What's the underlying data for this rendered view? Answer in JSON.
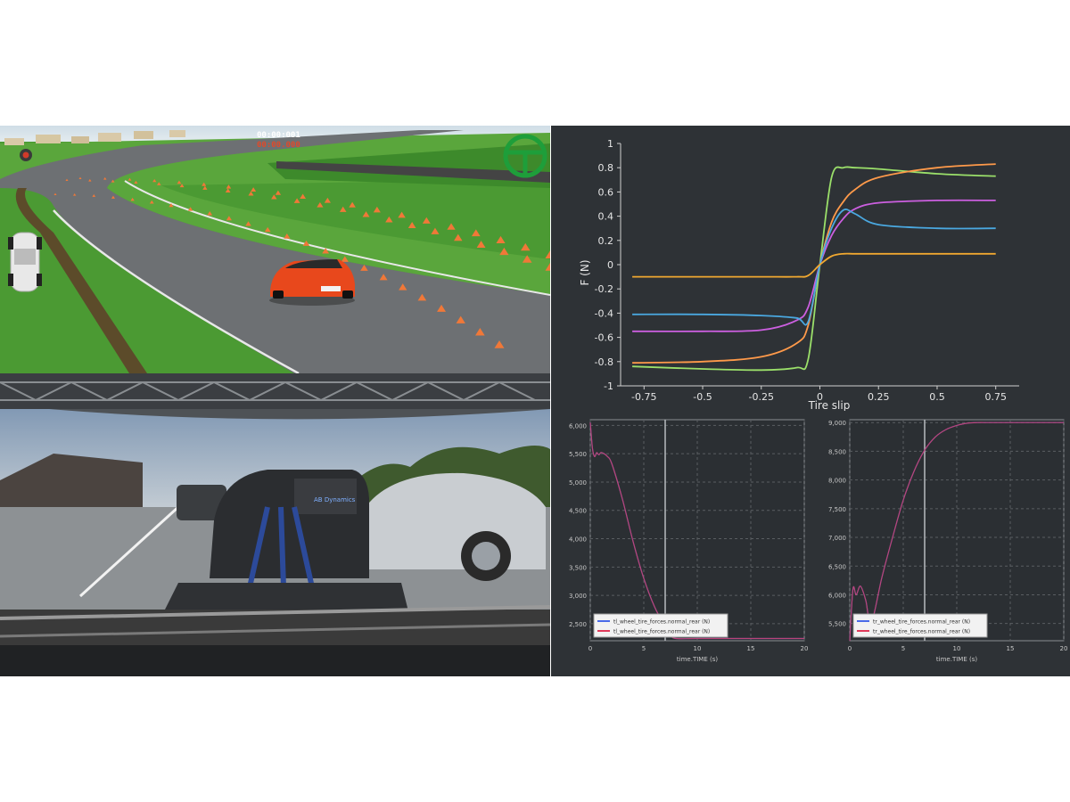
{
  "simulator": {
    "timer_primary": "00:00:001",
    "timer_secondary": "00:00.000",
    "icons": [
      "steering-wheel-icon",
      "car-topview-icon",
      "record-icon"
    ],
    "colors": {
      "car": "#e8481c",
      "wheel": "#1e9e3a",
      "timer_secondary": "#e04a2a"
    }
  },
  "photo": {
    "sign_text": "AB Dynamics"
  },
  "tire_chart": {
    "chart_data": {
      "type": "line",
      "xlabel": "Tire slip",
      "ylabel": "F (N)",
      "xlim": [
        -0.85,
        0.85
      ],
      "ylim": [
        -1,
        1
      ],
      "xticks": [
        "-0.75",
        "-0.5",
        "-0.25",
        "0",
        "0.25",
        "0.5",
        "0.75"
      ],
      "yticks": [
        "1",
        "0.8",
        "0.6",
        "0.4",
        "0.2",
        "0",
        "-0.2",
        "-0.4",
        "-0.6",
        "-0.8",
        "-1"
      ],
      "grid": false,
      "series": [
        {
          "color": "#9be06a",
          "x": [
            -0.8,
            -0.5,
            -0.25,
            -0.1,
            -0.05,
            0,
            0.05,
            0.1,
            0.15,
            0.25,
            0.5,
            0.75
          ],
          "y": [
            -0.84,
            -0.86,
            -0.87,
            -0.85,
            -0.78,
            0,
            0.72,
            0.8,
            0.8,
            0.79,
            0.75,
            0.73
          ]
        },
        {
          "color": "#ff9a4a",
          "x": [
            -0.8,
            -0.5,
            -0.25,
            -0.1,
            -0.05,
            0,
            0.05,
            0.1,
            0.15,
            0.25,
            0.5,
            0.75
          ],
          "y": [
            -0.81,
            -0.8,
            -0.76,
            -0.65,
            -0.5,
            0,
            0.35,
            0.52,
            0.62,
            0.72,
            0.8,
            0.83
          ]
        },
        {
          "color": "#cc5fe0",
          "x": [
            -0.8,
            -0.5,
            -0.25,
            -0.1,
            -0.05,
            0,
            0.05,
            0.1,
            0.15,
            0.25,
            0.5,
            0.75
          ],
          "y": [
            -0.55,
            -0.55,
            -0.54,
            -0.46,
            -0.35,
            0,
            0.24,
            0.38,
            0.46,
            0.51,
            0.53,
            0.53
          ]
        },
        {
          "color": "#4aa8e0",
          "x": [
            -0.8,
            -0.5,
            -0.25,
            -0.1,
            -0.05,
            0,
            0.05,
            0.1,
            0.15,
            0.25,
            0.5,
            0.75
          ],
          "y": [
            -0.41,
            -0.41,
            -0.42,
            -0.44,
            -0.47,
            0,
            0.3,
            0.45,
            0.42,
            0.33,
            0.3,
            0.3
          ]
        },
        {
          "color": "#f0a830",
          "x": [
            -0.8,
            -0.5,
            -0.25,
            -0.1,
            -0.05,
            0,
            0.05,
            0.1,
            0.15,
            0.25,
            0.5,
            0.75
          ],
          "y": [
            -0.1,
            -0.1,
            -0.1,
            -0.1,
            -0.09,
            0,
            0.07,
            0.09,
            0.09,
            0.09,
            0.09,
            0.09
          ]
        }
      ]
    }
  },
  "time_charts": [
    {
      "chart_data": {
        "type": "line",
        "xlabel": "time.TIME (s)",
        "xlim": [
          0,
          20
        ],
        "ylim": [
          2200,
          6100
        ],
        "xticks": [
          "0",
          "5",
          "10",
          "15",
          "20"
        ],
        "yticks": [
          "6,000",
          "5,500",
          "5,000",
          "4,500",
          "4,000",
          "3,500",
          "3,000",
          "2,500"
        ],
        "grid": true,
        "legend_position": "bottom-left",
        "cursor_x": 7,
        "series": [
          {
            "name": "tl_wheel_tire_forces.normal_rear (N)",
            "color": "#4a6ae8",
            "x": [
              0,
              0.2,
              0.4,
              0.6,
              0.8,
              1,
              1.3,
              1.6,
              2,
              3,
              4,
              5,
              6,
              7,
              7.5,
              8,
              10,
              15,
              20
            ],
            "y": [
              6050,
              5600,
              5450,
              5520,
              5480,
              5520,
              5500,
              5450,
              5330,
              4700,
              3950,
              3300,
              2800,
              2450,
              2300,
              2240,
              2240,
              2240,
              2240
            ]
          },
          {
            "name": "tl_wheel_tire_forces.normal_rear (N)",
            "color": "#e03a5a",
            "x": [
              0,
              0.2,
              0.4,
              0.6,
              0.8,
              1,
              1.3,
              1.6,
              2,
              3,
              4,
              5,
              6,
              7,
              7.5,
              8,
              10,
              15,
              20
            ],
            "y": [
              6050,
              5600,
              5450,
              5520,
              5480,
              5520,
              5500,
              5450,
              5330,
              4700,
              3950,
              3300,
              2800,
              2450,
              2300,
              2240,
              2240,
              2240,
              2240
            ]
          }
        ]
      }
    },
    {
      "chart_data": {
        "type": "line",
        "xlabel": "time.TIME (s)",
        "xlim": [
          0,
          20
        ],
        "ylim": [
          5200,
          9050
        ],
        "xticks": [
          "0",
          "5",
          "10",
          "15",
          "20"
        ],
        "yticks": [
          "9,000",
          "8,500",
          "8,000",
          "7,500",
          "7,000",
          "6,500",
          "6,000",
          "5,500"
        ],
        "grid": true,
        "legend_position": "bottom-left",
        "cursor_x": 7,
        "series": [
          {
            "name": "tr_wheel_tire_forces.normal_rear (N)",
            "color": "#4a6ae8",
            "x": [
              0,
              0.3,
              0.6,
              1,
              1.5,
              2,
              3,
              4,
              5,
              6,
              7,
              8,
              9,
              10,
              11,
              12,
              13,
              15,
              20
            ],
            "y": [
              5200,
              6100,
              6000,
              6150,
              5900,
              5500,
              6300,
              7000,
              7650,
              8150,
              8520,
              8750,
              8880,
              8950,
              8990,
              9000,
              9000,
              9000,
              9000
            ]
          },
          {
            "name": "tr_wheel_tire_forces.normal_rear (N)",
            "color": "#e03a5a",
            "x": [
              0,
              0.3,
              0.6,
              1,
              1.5,
              2,
              3,
              4,
              5,
              6,
              7,
              8,
              9,
              10,
              11,
              12,
              13,
              15,
              20
            ],
            "y": [
              5200,
              6100,
              6000,
              6150,
              5900,
              5500,
              6300,
              7000,
              7650,
              8150,
              8520,
              8750,
              8880,
              8950,
              8990,
              9000,
              9000,
              9000,
              9000
            ]
          }
        ]
      }
    }
  ]
}
